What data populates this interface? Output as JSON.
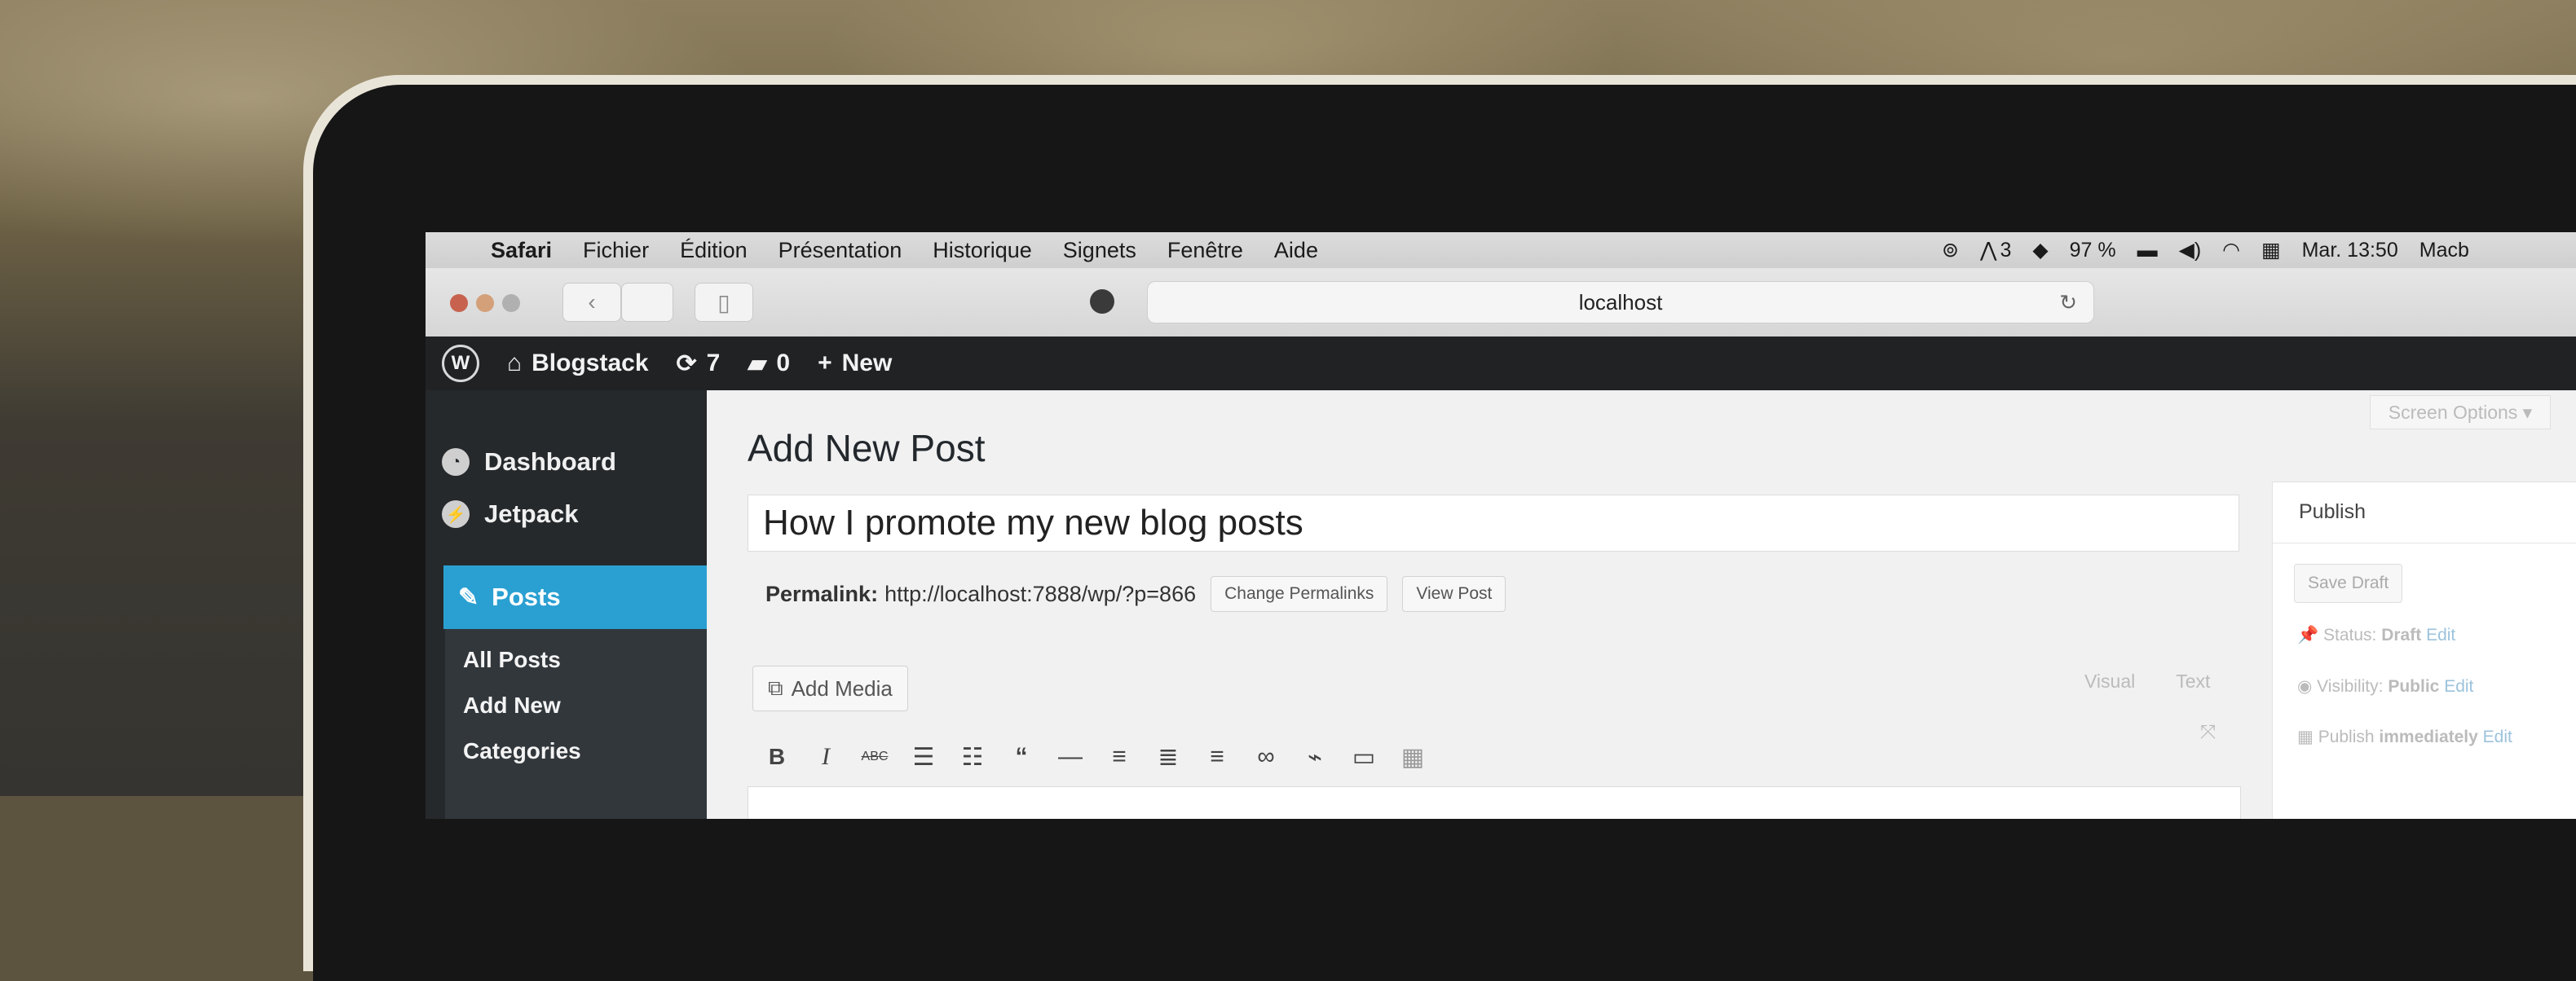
{
  "colors": {
    "wp_sidebar": "#25292c",
    "wp_submenu": "#32373c",
    "wp_active": "#2aa0d2",
    "wp_adminbar": "#202224",
    "mac_menubar": "#d6d6d6"
  },
  "mac_menu": {
    "apple_icon": "apple-icon",
    "items": [
      "Safari",
      "Fichier",
      "Édition",
      "Présentation",
      "Historique",
      "Signets",
      "Fenêtre",
      "Aide"
    ],
    "status": {
      "adobe": "3",
      "battery": "97 %",
      "clock": "Mar. 13:50",
      "user": "Macb"
    }
  },
  "safari": {
    "url": "localhost"
  },
  "admin_bar": {
    "site_name": "Blogstack",
    "updates_count": "7",
    "comments_count": "0",
    "new_label": "New"
  },
  "sidebar": {
    "dashboard": "Dashboard",
    "jetpack": "Jetpack",
    "posts": "Posts",
    "submenu": [
      "All Posts",
      "Add New",
      "Categories"
    ]
  },
  "editor": {
    "screen_options": "Screen Options ▾",
    "page_title": "Add New Post",
    "post_title": "How I promote my new blog posts",
    "permalink_label": "Permalink:",
    "permalink_url": "http://localhost:7888/wp/?p=866",
    "change_permalinks": "Change Permalinks",
    "view_post": "View Post",
    "add_media": "Add Media",
    "visual_tab": "Visual",
    "text_tab": "Text"
  },
  "publish": {
    "heading": "Publish",
    "save_draft": "Save Draft",
    "status_label": "Status:",
    "status_value": "Draft",
    "status_edit": "Edit",
    "visibility_label": "Visibility:",
    "visibility_value": "Public",
    "visibility_edit": "Edit",
    "publish_label": "Publish",
    "publish_value": "immediately",
    "publish_edit": "Edit"
  }
}
